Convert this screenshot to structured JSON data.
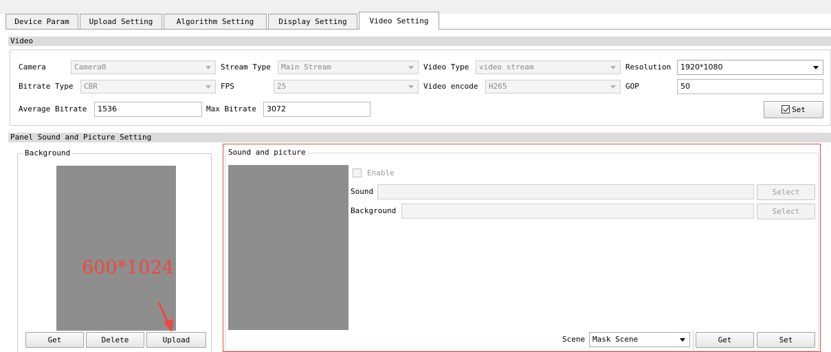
{
  "tabs": [
    {
      "label": "Device Param"
    },
    {
      "label": "Upload Setting"
    },
    {
      "label": "Algorithm Setting"
    },
    {
      "label": "Display Setting"
    },
    {
      "label": "Video Setting",
      "active": true
    }
  ],
  "video": {
    "section_title": "Video",
    "camera": {
      "label": "Camera",
      "value": "Camera0"
    },
    "stream_type": {
      "label": "Stream Type",
      "value": "Main Stream"
    },
    "video_type": {
      "label": "Video Type",
      "value": "video stream"
    },
    "resolution": {
      "label": "Resolution",
      "value": "1920*1080"
    },
    "bitrate_type": {
      "label": "Bitrate Type",
      "value": "CBR"
    },
    "fps": {
      "label": "FPS",
      "value": "25"
    },
    "video_encode": {
      "label": "Video encode",
      "value": "H265"
    },
    "gop": {
      "label": "GOP",
      "value": "50"
    },
    "average_bitrate": {
      "label": "Average Bitrate",
      "value": "1536"
    },
    "max_bitrate": {
      "label": "Max Bitrate",
      "value": "3072"
    },
    "set_label": "Set"
  },
  "panel": {
    "section_title": "Panel Sound and Picture Setting",
    "background_group": {
      "title": "Background",
      "size_text": "600*1024",
      "get_label": "Get",
      "delete_label": "Delete",
      "upload_label": "Upload"
    },
    "sound_group": {
      "title": "Sound and picture",
      "enable_label": "Enable",
      "sound_label": "Sound",
      "sound_value": "",
      "background_label": "Background",
      "background_value": "",
      "select_label": "Select",
      "scene_label": "Scene",
      "scene_value": "Mask Scene",
      "get_label": "Get",
      "set_label": "Set"
    }
  },
  "colors": {
    "highlight_border": "#e84545",
    "annotation_red": "#f0463c",
    "preview_gray": "#8e8e8e"
  }
}
